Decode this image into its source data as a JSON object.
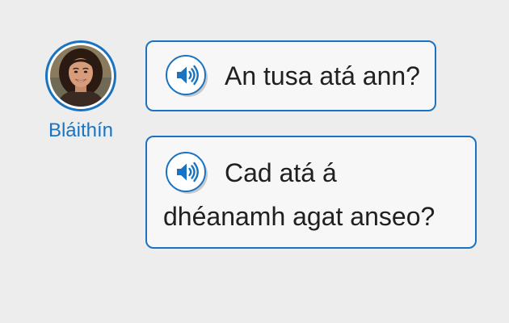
{
  "speaker": {
    "name": "Bláithín"
  },
  "messages": [
    {
      "lines": [
        "An tusa atá ann?"
      ]
    },
    {
      "lines": [
        "Cad atá á",
        "dhéanamh agat anseo?"
      ]
    }
  ],
  "icons": {
    "audio": "speaker-volume-icon",
    "avatar": "woman-portrait"
  },
  "colors": {
    "accent": "#1a73c1",
    "bubble_bg": "#f7f7f7",
    "page_bg": "#ededed",
    "text": "#202020"
  }
}
